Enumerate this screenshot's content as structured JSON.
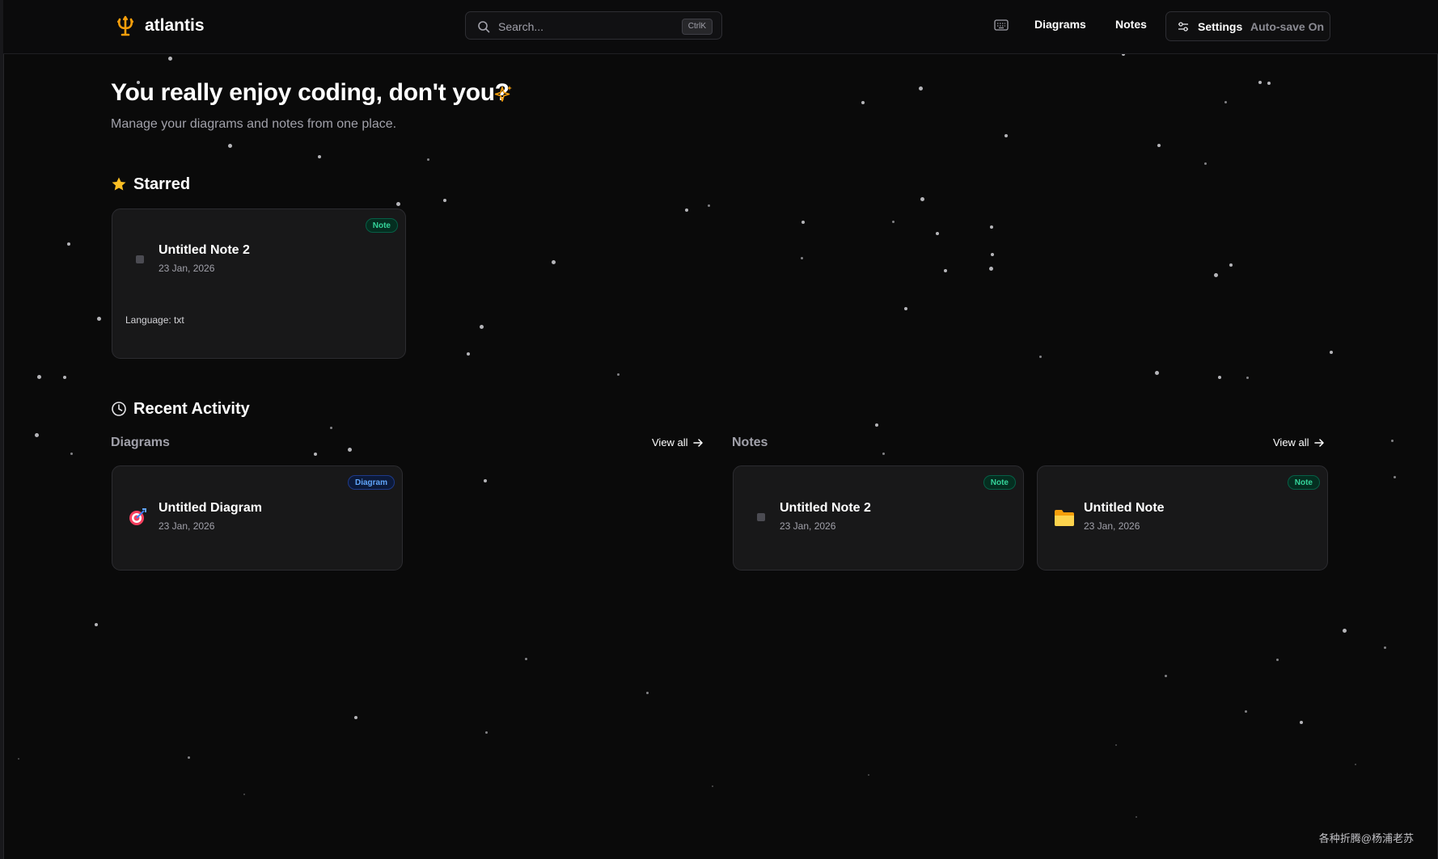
{
  "brand": {
    "name": "atlantis",
    "accent": "#f59e0b"
  },
  "search": {
    "placeholder": "Search...",
    "shortcut": "CtrlK"
  },
  "nav": {
    "keyboard_icon": "keyboard-icon",
    "diagrams": "Diagrams",
    "notes": "Notes",
    "settings": "Settings",
    "autosave": "Auto-save On"
  },
  "hero": {
    "title": "You really enjoy coding, don't you?",
    "subtitle": "Manage your diagrams and notes from one place."
  },
  "starred": {
    "title": "Starred",
    "items": [
      {
        "title": "Untitled Note 2",
        "date": "23 Jan, 2026",
        "badge": "Note",
        "language": "Language: txt",
        "icon": "file-icon"
      }
    ]
  },
  "recent": {
    "title": "Recent Activity",
    "diagrams": {
      "title": "Diagrams",
      "view_all": "View all",
      "items": [
        {
          "title": "Untitled Diagram",
          "date": "23 Jan, 2026",
          "badge": "Diagram",
          "icon": "target-icon"
        }
      ]
    },
    "notes": {
      "title": "Notes",
      "view_all": "View all",
      "items": [
        {
          "title": "Untitled Note 2",
          "date": "23 Jan, 2026",
          "badge": "Note",
          "icon": "file-icon"
        },
        {
          "title": "Untitled Note",
          "date": "23 Jan, 2026",
          "badge": "Note",
          "icon": "folder-icon"
        }
      ]
    }
  },
  "colors": {
    "background": "#0a0a0a",
    "card": "#181819",
    "note_badge": "#34d399",
    "diagram_badge": "#60a5fa",
    "star": "#fbbf24"
  },
  "watermark": "各种折腾@杨浦老苏"
}
